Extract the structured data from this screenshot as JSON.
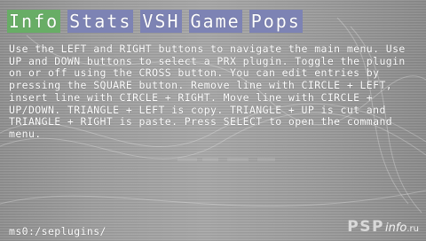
{
  "menu": {
    "tabs": [
      {
        "label": "Info",
        "active": true
      },
      {
        "label": "Stats",
        "active": false
      },
      {
        "label": "VSH",
        "active": false
      },
      {
        "label": "Game",
        "active": false
      },
      {
        "label": "Pops",
        "active": false
      }
    ]
  },
  "info": {
    "help_text": "Use the LEFT and RIGHT buttons to navigate the main menu. Use UP and DOWN buttons to select a PRX plugin. Toggle the plugin on or off using the CROSS button. You can edit entries by pressing the SQUARE button. Remove line with CIRCLE + LEFT, insert line with CIRCLE + RIGHT. Move line with CIRCLE + UP/DOWN. TRIANGLE + LEFT is copy. TRIANGLE + UP is cut and TRIANGLE + RIGHT is paste. Press SELECT to open the command menu."
  },
  "footer": {
    "path": "ms0:/seplugins/"
  },
  "watermark": {
    "main": "PSP",
    "sub": "info",
    "tld": ".ru"
  },
  "colors": {
    "tab_active": "#68ad66",
    "tab_inactive": "#7d83b4",
    "text": "#ffffff",
    "background": "#9a9a9a"
  }
}
